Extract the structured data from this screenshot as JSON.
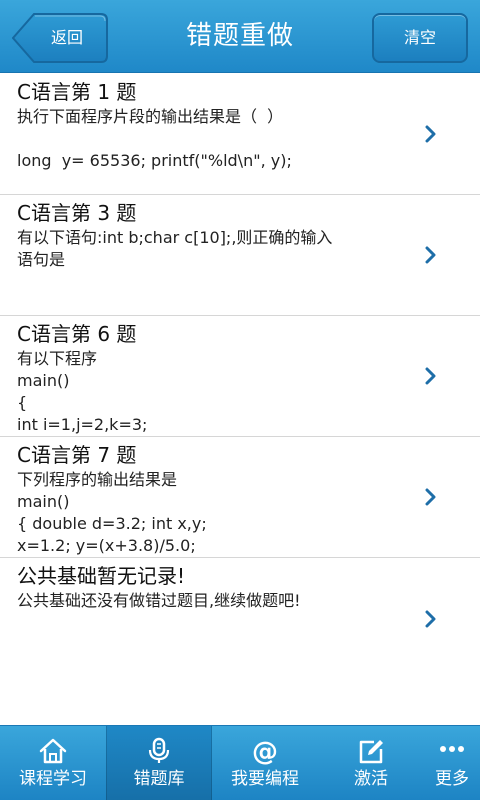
{
  "header": {
    "title": "错题重做",
    "back_label": "返回",
    "clear_label": "清空"
  },
  "items": [
    {
      "title": "C语言第 1 题",
      "body": "执行下面程序片段的输出结果是（  ）\n\nlong  y= 65536; printf(\"%ld\\n\", y);"
    },
    {
      "title": "C语言第 3 题",
      "body": "有以下语句:int b;char c[10];,则正确的输入语句是"
    },
    {
      "title": "C语言第 6 题",
      "body": "有以下程序\nmain()\n{\nint i=1,j=2,k=3;"
    },
    {
      "title": "C语言第 7 题",
      "body": "下列程序的输出结果是\nmain()\n{ double d=3.2; int x,y;\nx=1.2; y=(x+3.8)/5.0;"
    },
    {
      "title": "公共基础暂无记录!",
      "body": "公共基础还没有做错过题目,继续做题吧!"
    }
  ],
  "tabs": [
    {
      "label": "课程学习",
      "icon": "home-icon"
    },
    {
      "label": "错题库",
      "icon": "microphone-icon"
    },
    {
      "label": "我要编程",
      "icon": "at-icon"
    },
    {
      "label": "激活",
      "icon": "edit-icon"
    },
    {
      "label": "更多",
      "icon": "more-icon"
    }
  ],
  "active_tab": 1,
  "colors": {
    "accent": "#2596d1",
    "chevron": "#1e6ea8"
  }
}
